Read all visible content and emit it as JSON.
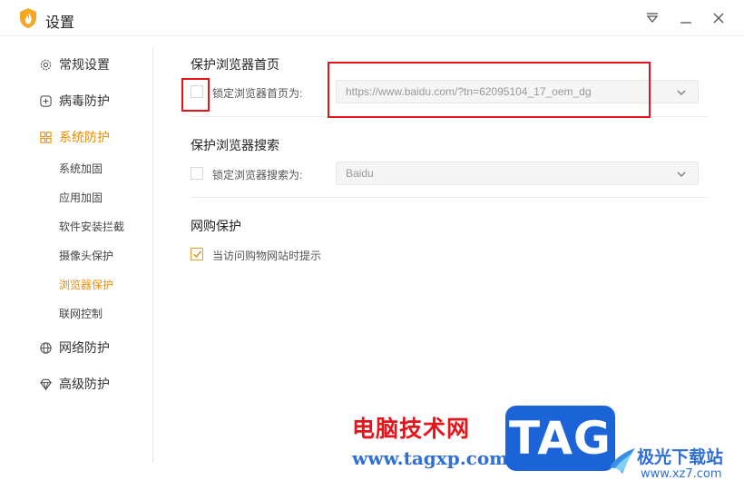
{
  "window": {
    "title": "设置",
    "controls": [
      "dropdown-icon",
      "minimize-icon",
      "close-icon"
    ]
  },
  "sidebar": {
    "items": [
      {
        "label": "常规设置",
        "icon": "gear-icon"
      },
      {
        "label": "病毒防护",
        "icon": "plus-square-icon"
      },
      {
        "label": "系统防护",
        "icon": "system-grid-icon",
        "active": true
      },
      {
        "label": "网络防护",
        "icon": "globe-icon"
      },
      {
        "label": "高级防护",
        "icon": "diamond-icon"
      }
    ],
    "subitems": [
      {
        "label": "系统加固"
      },
      {
        "label": "应用加固"
      },
      {
        "label": "软件安装拦截"
      },
      {
        "label": "摄像头保护"
      },
      {
        "label": "浏览器保护",
        "active": true
      },
      {
        "label": "联网控制"
      }
    ]
  },
  "homepage": {
    "title": "保护浏览器首页",
    "checkbox_label": "锁定浏览器首页为:",
    "checked": false,
    "value": "https://www.baidu.com/?tn=62095104_17_oem_dg"
  },
  "search": {
    "title": "保护浏览器搜索",
    "checkbox_label": "锁定浏览器搜索为:",
    "checked": false,
    "value": "Baidu"
  },
  "shopping": {
    "title": "网购保护",
    "checkbox_label": "当访问购物网站时提示",
    "checked": true
  },
  "watermark": {
    "cn": "电脑技术网",
    "url": "www.tagxp.com",
    "tag": "TAG",
    "site_name": "极光下载站",
    "site_url": "www.xz7.com"
  },
  "colors": {
    "accent": "#f08c00",
    "annotation": "#e8141b",
    "watermark_blue": "#1a64d8"
  }
}
